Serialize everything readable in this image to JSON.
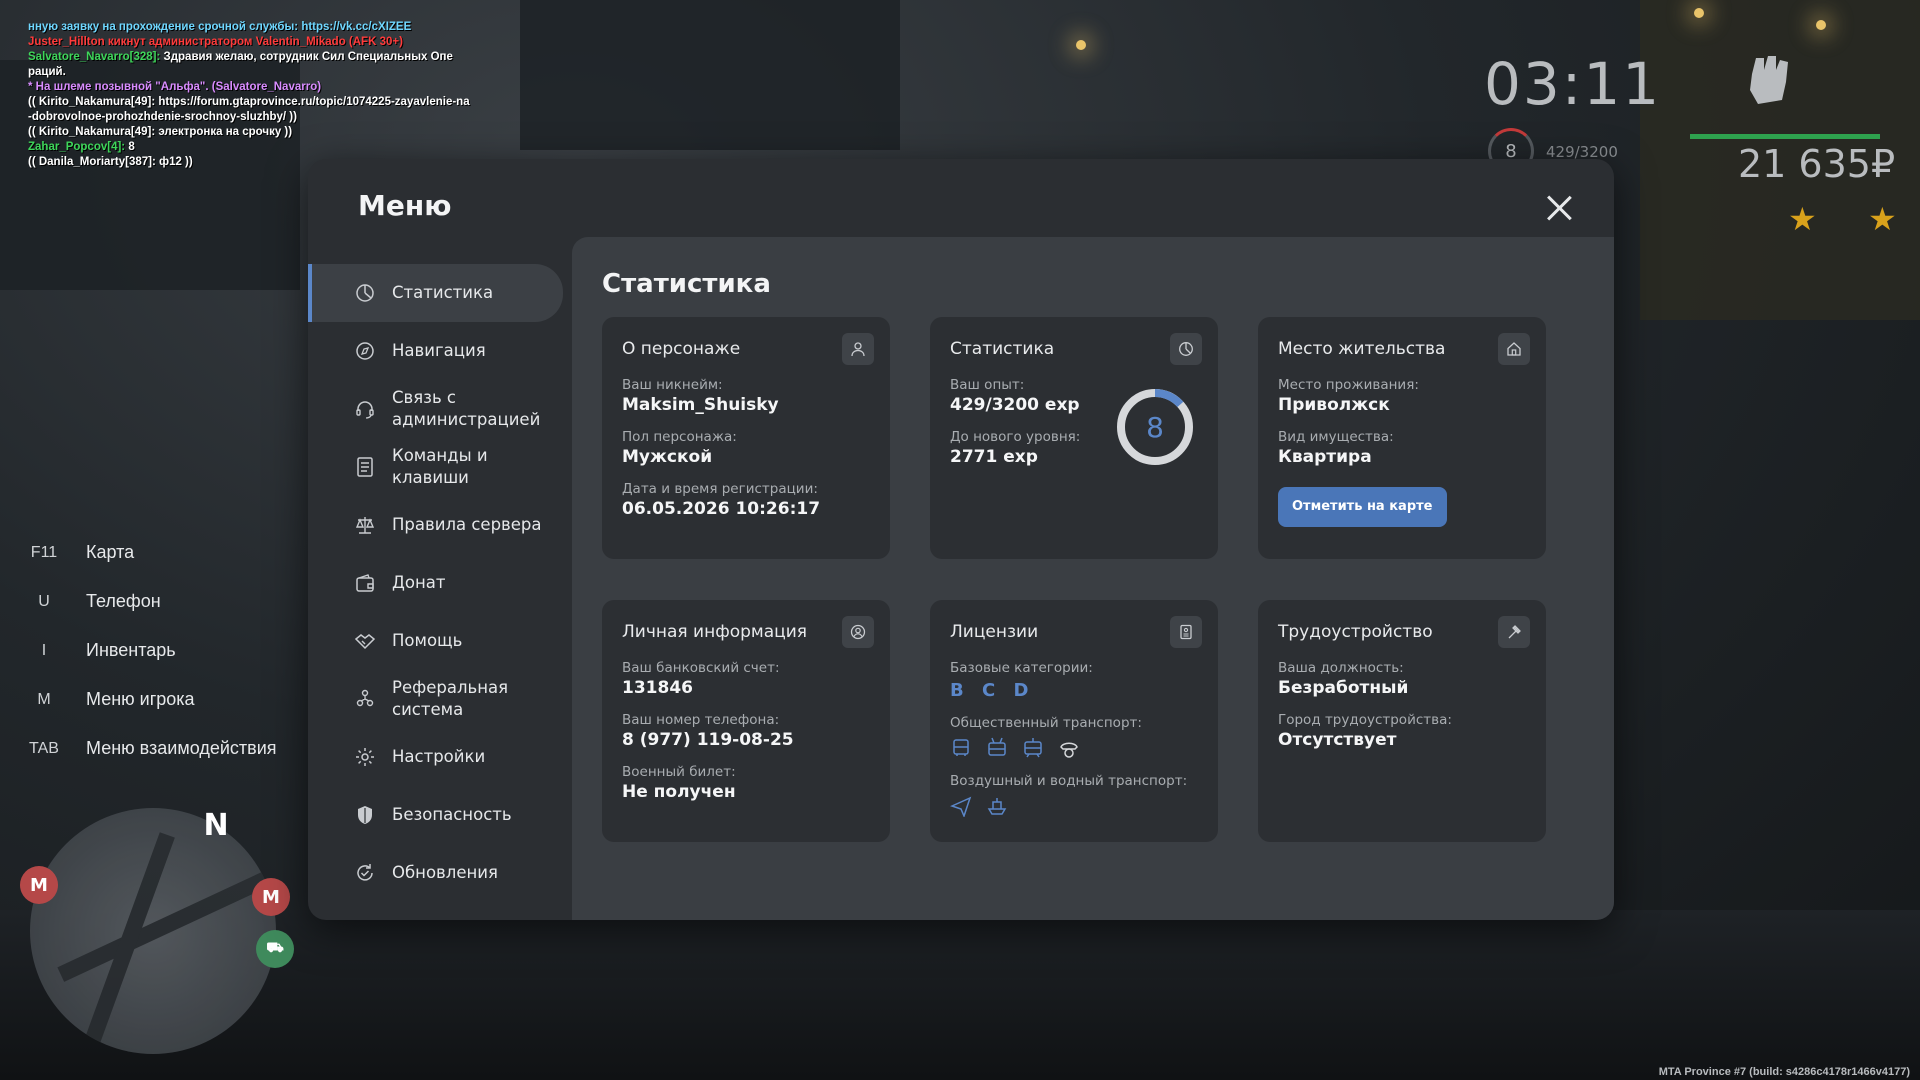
{
  "chat": [
    {
      "text": "нную заявку на прохождение срочной службы: https://vk.cc/cXIZEE",
      "color": "#6fd7ff"
    },
    {
      "text": "Juster_Hillton кикнут администратором Valentin_Mikado (AFK 30+)",
      "color": "#ff3b3b"
    },
    {
      "text": "Salvatore_Navarro[328]:",
      "color": "#3ed65a",
      "rest": " Здравия желаю, сотрудник Сил Специальных Опе"
    },
    {
      "text": "раций.",
      "color": "#ffffff"
    },
    {
      "text": "* На шлеме позывной \"Альфа\". (Salvatore_Navarro)",
      "color": "#d98cff"
    },
    {
      "text": "(( Kirito_Nakamura[49]: https://forum.gtaprovince.ru/topic/1074225-zayavlenie-na",
      "color": "#ffffff"
    },
    {
      "text": "-dobrovolnoe-prohozhdenie-srochnoy-sluzhby/ ))",
      "color": "#ffffff"
    },
    {
      "text": "(( Kirito_Nakamura[49]: электронка на срочку ))",
      "color": "#ffffff"
    },
    {
      "text": "Zahar_Popcov[4]:",
      "color": "#3ed65a",
      "rest": " 8"
    },
    {
      "text": "(( Danila_Moriarty[387]: ф12 ))",
      "color": "#ffffff"
    }
  ],
  "hud": {
    "time": "03:11",
    "level": "8",
    "exp": "429/3200",
    "money": "21 635₽",
    "wanted_stars": 2
  },
  "hotkeys": [
    {
      "key": "F11",
      "label": "Карта"
    },
    {
      "key": "U",
      "label": "Телефон"
    },
    {
      "key": "I",
      "label": "Инвентарь"
    },
    {
      "key": "M",
      "label": "Меню игрока"
    },
    {
      "key": "TAB",
      "label": "Меню взаимодействия"
    }
  ],
  "minimap": {
    "north": "N",
    "metro": "M"
  },
  "build_info": "MTA Province #7 (build: s4286c4178r1466v4177)",
  "menu": {
    "title": "Меню",
    "nav": [
      {
        "label": "Статистика",
        "icon": "pie-chart-icon",
        "active": true
      },
      {
        "label": "Навигация",
        "icon": "compass-icon"
      },
      {
        "label": "Связь с администрацией",
        "icon": "headset-icon"
      },
      {
        "label": "Команды и клавиши",
        "icon": "document-icon"
      },
      {
        "label": "Правила сервера",
        "icon": "scales-icon"
      },
      {
        "label": "Донат",
        "icon": "wallet-icon"
      },
      {
        "label": "Помощь",
        "icon": "handshake-icon"
      },
      {
        "label": "Реферальная система",
        "icon": "users-icon"
      },
      {
        "label": "Настройки",
        "icon": "gear-icon"
      },
      {
        "label": "Безопасность",
        "icon": "shield-icon"
      },
      {
        "label": "Обновления",
        "icon": "refresh-check-icon"
      }
    ],
    "content_title": "Статистика",
    "cards": {
      "character": {
        "title": "О персонаже",
        "nickname_label": "Ваш никнейм:",
        "nickname": "Maksim_Shuisky",
        "gender_label": "Пол персонажа:",
        "gender": "Мужской",
        "reg_label": "Дата и время регистрации:",
        "reg_date": "06.05.2026 10:26:17"
      },
      "stats": {
        "title": "Статистика",
        "exp_label": "Ваш опыт:",
        "exp": "429/3200 exp",
        "next_label": "До нового уровня:",
        "next": "2771 exp",
        "level": "8",
        "level_progress": 0.134
      },
      "residence": {
        "title": "Место жительства",
        "place_label": "Место проживания:",
        "place": "Приволжск",
        "property_label": "Вид имущества:",
        "property": "Квартира",
        "button": "Отметить на карте"
      },
      "personal": {
        "title": "Личная информация",
        "bank_label": "Ваш банковский счет:",
        "bank": "131846",
        "phone_label": "Ваш номер телефона:",
        "phone": "8 (977) 119-08-25",
        "military_label": "Военный билет:",
        "military": "Не получен"
      },
      "licenses": {
        "title": "Лицензии",
        "base_label": "Базовые категории:",
        "base": "B C D",
        "public_label": "Общественный транспорт:",
        "public_icons": [
          "bus-icon",
          "trolleybus-icon",
          "tram-icon",
          "taxi-cap-icon"
        ],
        "air_label": "Воздушный и водный транспорт:",
        "air_icons": [
          "plane-icon",
          "boat-icon"
        ]
      },
      "employment": {
        "title": "Трудоустройство",
        "position_label": "Ваша должность:",
        "position": "Безработный",
        "city_label": "Город трудоустройства:",
        "city": "Отсутствует"
      }
    }
  },
  "colors": {
    "accent": "#5b87c9",
    "button": "#4a76b8",
    "panel": "#2b2e32",
    "card": "#2c2f33",
    "content": "#3a3e43"
  }
}
